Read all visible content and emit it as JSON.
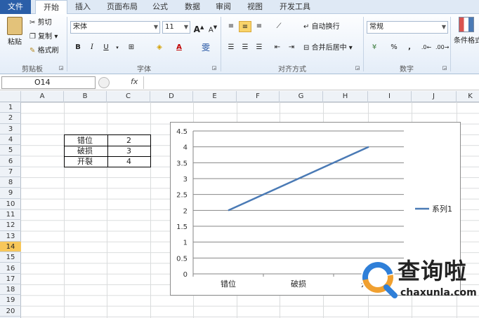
{
  "tabs": [
    "文件",
    "开始",
    "插入",
    "页面布局",
    "公式",
    "数据",
    "审阅",
    "视图",
    "开发工具"
  ],
  "ribbon": {
    "paste": "粘贴",
    "cut": "剪切",
    "copy": "复制",
    "format_painter": "格式刷",
    "clipboard_label": "剪贴板",
    "font_name": "宋体",
    "font_size": "11",
    "font_label": "字体",
    "bold": "B",
    "italic": "I",
    "underline": "U",
    "grow": "A",
    "shrink": "A",
    "wen": "雯",
    "wrap": "自动换行",
    "merge": "合并后居中",
    "align_label": "对齐方式",
    "number_format": "常规",
    "pct": "%",
    "comma": ",",
    "number_label": "数字",
    "cond_format": "条件格式"
  },
  "formula_bar": {
    "name_box": "O14",
    "fx": "fx",
    "value": ""
  },
  "columns": [
    "A",
    "B",
    "C",
    "D",
    "E",
    "F",
    "G",
    "H",
    "I",
    "J",
    "K"
  ],
  "rows": [
    "1",
    "2",
    "3",
    "4",
    "5",
    "6",
    "7",
    "8",
    "9",
    "10",
    "11",
    "12",
    "13",
    "14",
    "15",
    "16",
    "17",
    "18",
    "19",
    "20"
  ],
  "selected_row": "14",
  "cells": [
    {
      "label": "错位",
      "value": "2"
    },
    {
      "label": "破损",
      "value": "3"
    },
    {
      "label": "开裂",
      "value": "4"
    }
  ],
  "chart_data": {
    "type": "line",
    "categories": [
      "错位",
      "破损",
      "开裂"
    ],
    "series": [
      {
        "name": "系列1",
        "values": [
          2,
          3,
          4
        ],
        "color": "#4a7ab5"
      }
    ],
    "ylim": [
      0,
      4.5
    ],
    "yticks": [
      "0",
      "0.5",
      "1",
      "1.5",
      "2",
      "2.5",
      "3",
      "3.5",
      "4",
      "4.5"
    ],
    "grid": true,
    "legend": "right"
  },
  "watermark": {
    "title": "查询啦",
    "url": "chaxunla.com"
  }
}
